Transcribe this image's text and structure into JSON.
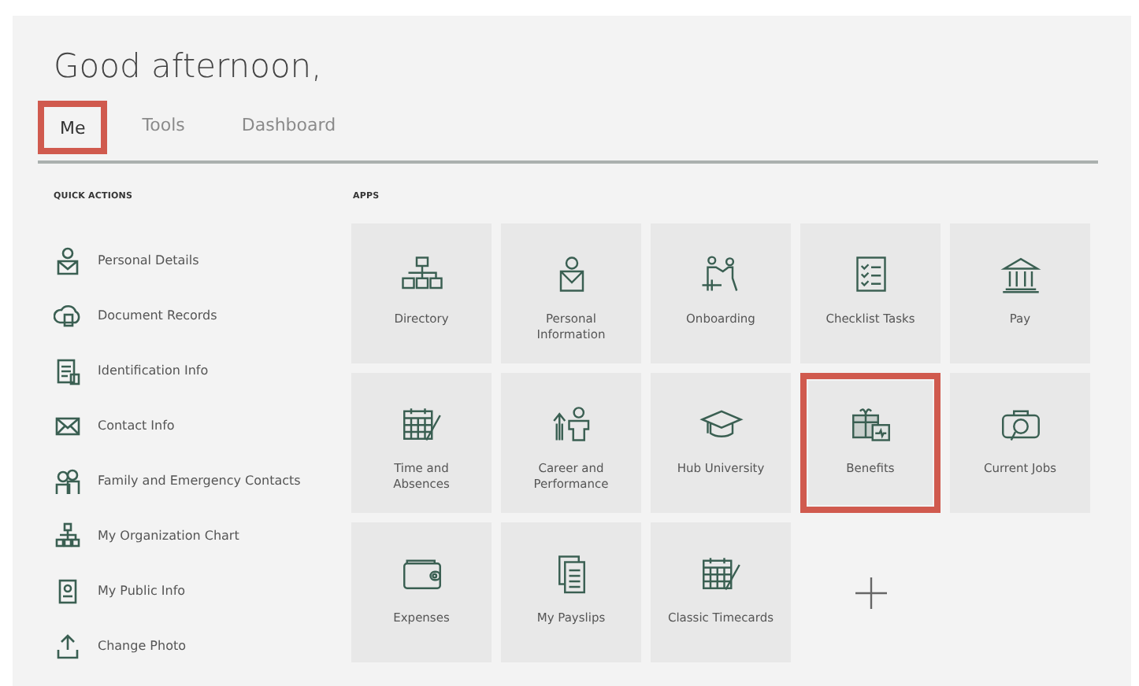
{
  "greeting": "Good afternoon,",
  "tabs": [
    {
      "label": "Me",
      "selected": true,
      "highlighted": true
    },
    {
      "label": "Tools",
      "selected": false,
      "highlighted": false
    },
    {
      "label": "Dashboard",
      "selected": false,
      "highlighted": false
    }
  ],
  "quick_actions": {
    "title": "QUICK ACTIONS",
    "items": [
      {
        "label": "Personal Details"
      },
      {
        "label": "Document Records"
      },
      {
        "label": "Identification Info"
      },
      {
        "label": "Contact Info"
      },
      {
        "label": "Family and Emergency Contacts"
      },
      {
        "label": "My Organization Chart"
      },
      {
        "label": "My Public Info"
      },
      {
        "label": "Change Photo"
      }
    ]
  },
  "apps": {
    "title": "APPS",
    "tiles": [
      {
        "kind": "app",
        "label": "Directory",
        "highlighted": false
      },
      {
        "kind": "app",
        "label": "Personal Information",
        "highlighted": false
      },
      {
        "kind": "app",
        "label": "Onboarding",
        "highlighted": false
      },
      {
        "kind": "app",
        "label": "Checklist Tasks",
        "highlighted": false
      },
      {
        "kind": "app",
        "label": "Pay",
        "highlighted": false
      },
      {
        "kind": "app",
        "label": "Time and Absences",
        "highlighted": false
      },
      {
        "kind": "app",
        "label": "Career and Performance",
        "highlighted": false
      },
      {
        "kind": "app",
        "label": "Hub University",
        "highlighted": false
      },
      {
        "kind": "app",
        "label": "Benefits",
        "highlighted": true
      },
      {
        "kind": "app",
        "label": "Current Jobs",
        "highlighted": false
      },
      {
        "kind": "app",
        "label": "Expenses",
        "highlighted": false
      },
      {
        "kind": "app",
        "label": "My Payslips",
        "highlighted": false
      },
      {
        "kind": "app",
        "label": "Classic Timecards",
        "highlighted": false
      },
      {
        "kind": "add"
      }
    ]
  }
}
